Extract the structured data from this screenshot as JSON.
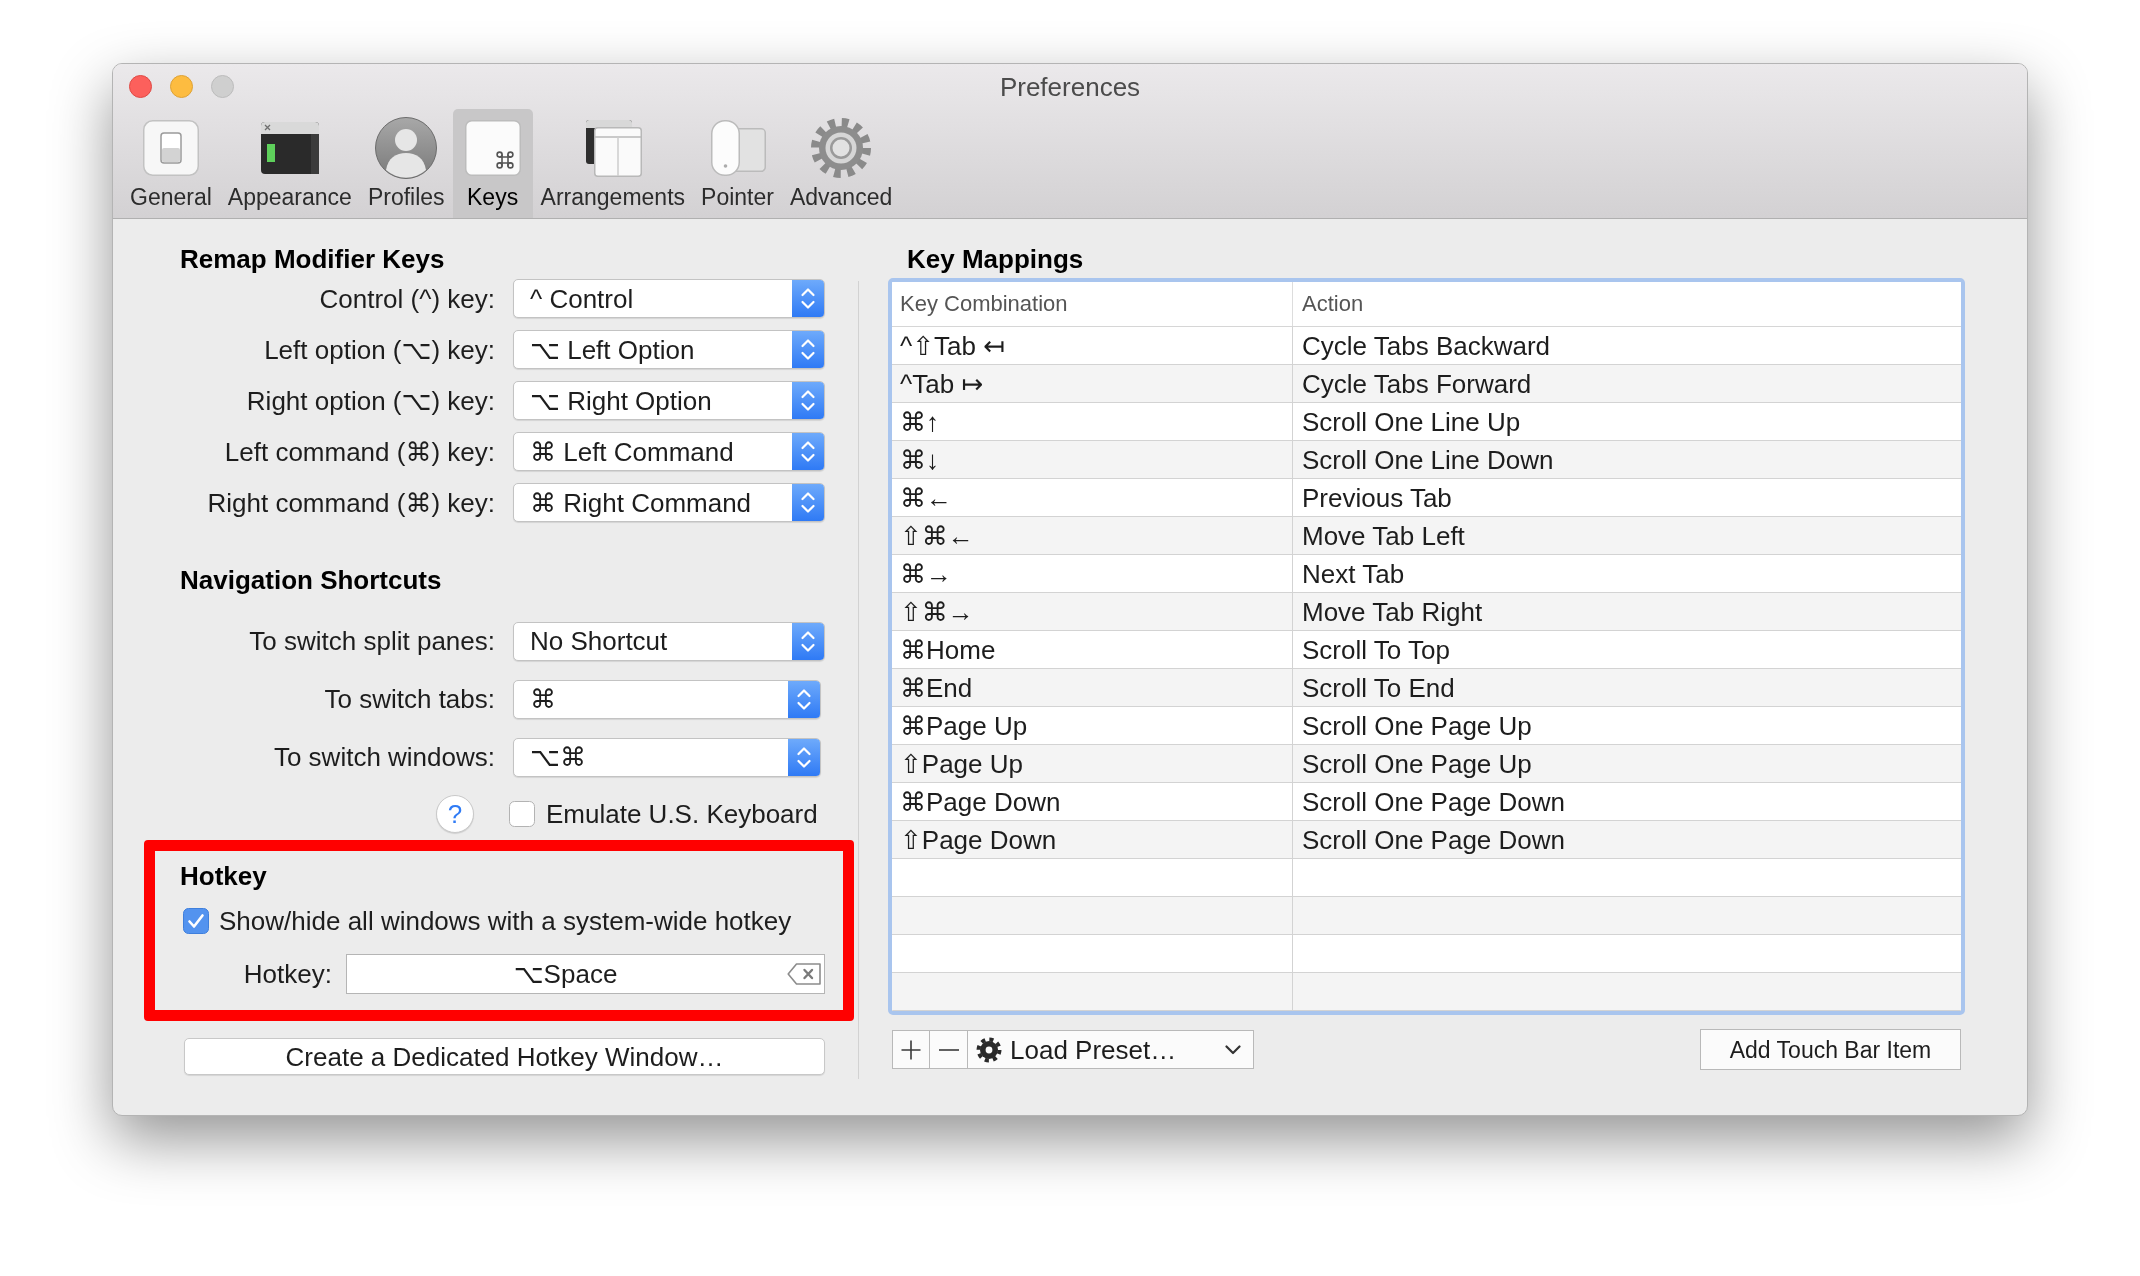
{
  "window": {
    "title": "Preferences",
    "zoom_button_enabled": false
  },
  "toolbar": {
    "items": [
      {
        "label": "General",
        "selected": false
      },
      {
        "label": "Appearance",
        "selected": false
      },
      {
        "label": "Profiles",
        "selected": false
      },
      {
        "label": "Keys",
        "selected": true
      },
      {
        "label": "Arrangements",
        "selected": false
      },
      {
        "label": "Pointer",
        "selected": false
      },
      {
        "label": "Advanced",
        "selected": false
      }
    ]
  },
  "remap_modifier_keys": {
    "heading": "Remap Modifier Keys",
    "rows": [
      {
        "label": "Control (^) key:",
        "value": "^ Control"
      },
      {
        "label": "Left option (⌥) key:",
        "value": "⌥ Left Option"
      },
      {
        "label": "Right option (⌥) key:",
        "value": "⌥ Right Option"
      },
      {
        "label": "Left command (⌘) key:",
        "value": "⌘ Left Command"
      },
      {
        "label": "Right command (⌘) key:",
        "value": "⌘ Right Command"
      }
    ]
  },
  "navigation_shortcuts": {
    "heading": "Navigation Shortcuts",
    "rows": [
      {
        "label": "To switch split panes:",
        "value": "No Shortcut"
      },
      {
        "label": "To switch tabs:",
        "value": "⌘"
      },
      {
        "label": "To switch windows:",
        "value": "⌥⌘"
      }
    ]
  },
  "help_button": {
    "label": "?"
  },
  "emulate_us_keyboard": {
    "label": "Emulate U.S. Keyboard",
    "checked": false
  },
  "hotkey": {
    "heading": "Hotkey",
    "highlighted": true,
    "show_hide": {
      "label": "Show/hide all windows with a system-wide hotkey",
      "checked": true
    },
    "field": {
      "label": "Hotkey:",
      "value": "⌥Space"
    }
  },
  "create_hotkey_window_button": {
    "label": "Create a Dedicated Hotkey Window…"
  },
  "key_mappings": {
    "heading": "Key Mappings",
    "columns": [
      "Key Combination",
      "Action"
    ],
    "rows": [
      {
        "key_combination": "^⇧Tab ↤",
        "action": "Cycle Tabs Backward"
      },
      {
        "key_combination": "^Tab ↦",
        "action": "Cycle Tabs Forward"
      },
      {
        "key_combination": "⌘↑",
        "action": "Scroll One Line Up"
      },
      {
        "key_combination": "⌘↓",
        "action": "Scroll One Line Down"
      },
      {
        "key_combination": "⌘←",
        "action": "Previous Tab"
      },
      {
        "key_combination": "⇧⌘←",
        "action": "Move Tab Left"
      },
      {
        "key_combination": "⌘→",
        "action": "Next Tab"
      },
      {
        "key_combination": "⇧⌘→",
        "action": "Move Tab Right"
      },
      {
        "key_combination": "⌘Home",
        "action": "Scroll To Top"
      },
      {
        "key_combination": "⌘End",
        "action": "Scroll To End"
      },
      {
        "key_combination": "⌘Page Up",
        "action": "Scroll One Page Up"
      },
      {
        "key_combination": "⇧Page Up",
        "action": "Scroll One Page Up"
      },
      {
        "key_combination": "⌘Page Down",
        "action": "Scroll One Page Down"
      },
      {
        "key_combination": "⇧Page Down",
        "action": "Scroll One Page Down"
      }
    ]
  },
  "load_preset": {
    "label": "Load Preset…"
  },
  "add_touch_bar_item_button": {
    "label": "Add Touch Bar Item"
  }
}
